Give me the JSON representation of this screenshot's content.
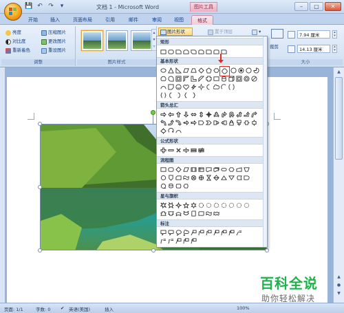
{
  "title_bar": {
    "title": "文档 1 - Microsoft Word",
    "context_tools_label": "图片工具",
    "window_controls": [
      "–",
      "▢",
      "✕"
    ]
  },
  "quick_access": [
    "💾",
    "↶",
    "↷",
    "▾"
  ],
  "tabs": [
    {
      "label": "开始",
      "active": false
    },
    {
      "label": "插入",
      "active": false
    },
    {
      "label": "页面布局",
      "active": false
    },
    {
      "label": "引用",
      "active": false
    },
    {
      "label": "邮件",
      "active": false
    },
    {
      "label": "审阅",
      "active": false
    },
    {
      "label": "视图",
      "active": false
    },
    {
      "label": "格式",
      "active": true
    }
  ],
  "ribbon": {
    "adjust": {
      "buttons": [
        "亮度",
        "对比度",
        "重新着色",
        "压缩图片",
        "更改图片",
        "重设图片"
      ],
      "label": "调整"
    },
    "picture_styles": {
      "label": "图片样式",
      "more": "▴ ▾ ▿"
    },
    "shape_button": "图片形状",
    "arrange": {
      "bring_front": "置于顶层",
      "align": "▾"
    },
    "size": {
      "crop_label": "裁剪",
      "height": "7.94 厘米",
      "width": "14.13 厘米",
      "label": "大小"
    }
  },
  "shape_panel": {
    "sections": [
      {
        "title": "矩形"
      },
      {
        "title": "基本形状"
      },
      {
        "title": "箭头总汇"
      },
      {
        "title": "公式形状"
      },
      {
        "title": "流程图"
      },
      {
        "title": "星与旗帜"
      },
      {
        "title": "标注"
      }
    ]
  },
  "status_bar": {
    "page": "页面: 1/1",
    "words": "字数: 0",
    "language": "英语(美国)",
    "mode": "插入",
    "zoom": "100%"
  },
  "watermark": {
    "title": "百科全说",
    "subtitle": "助你轻松解决"
  },
  "colors": {
    "accent_tab": "#f1cbd8",
    "highlight_red": "#e8261f",
    "watermark_green": "#20b24a"
  }
}
